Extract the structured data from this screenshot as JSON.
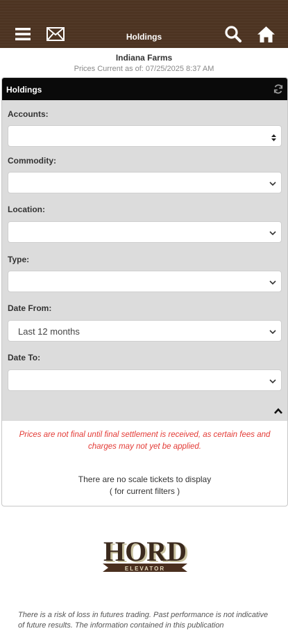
{
  "header": {
    "title": "Holdings",
    "icons": [
      "menu-icon",
      "mail-icon",
      "search-icon",
      "home-icon"
    ]
  },
  "company_name": "Indiana Farms",
  "prices_current": "Prices Current as of: 07/25/2025 8:37 AM",
  "panel": {
    "title": "Holdings",
    "filters": {
      "accounts": {
        "label": "Accounts:",
        "value": ""
      },
      "commodity": {
        "label": "Commodity:",
        "value": ""
      },
      "location": {
        "label": "Location:",
        "value": ""
      },
      "type": {
        "label": "Type:",
        "value": ""
      },
      "date_from": {
        "label": "Date From:",
        "value": "Last 12 months"
      },
      "date_to": {
        "label": "Date To:",
        "value": ""
      }
    },
    "disclaimer": "Prices are not final until final settlement is received, as certain fees and charges may not yet be applied.",
    "empty_line1": "There are no scale tickets to display",
    "empty_line2": "( for current filters )"
  },
  "logo": {
    "top": "HORD",
    "bottom": "ELEVATOR"
  },
  "footer_text": "There is a risk of loss in futures trading. Past performance is not indicative of future results. The information contained in this publication"
}
